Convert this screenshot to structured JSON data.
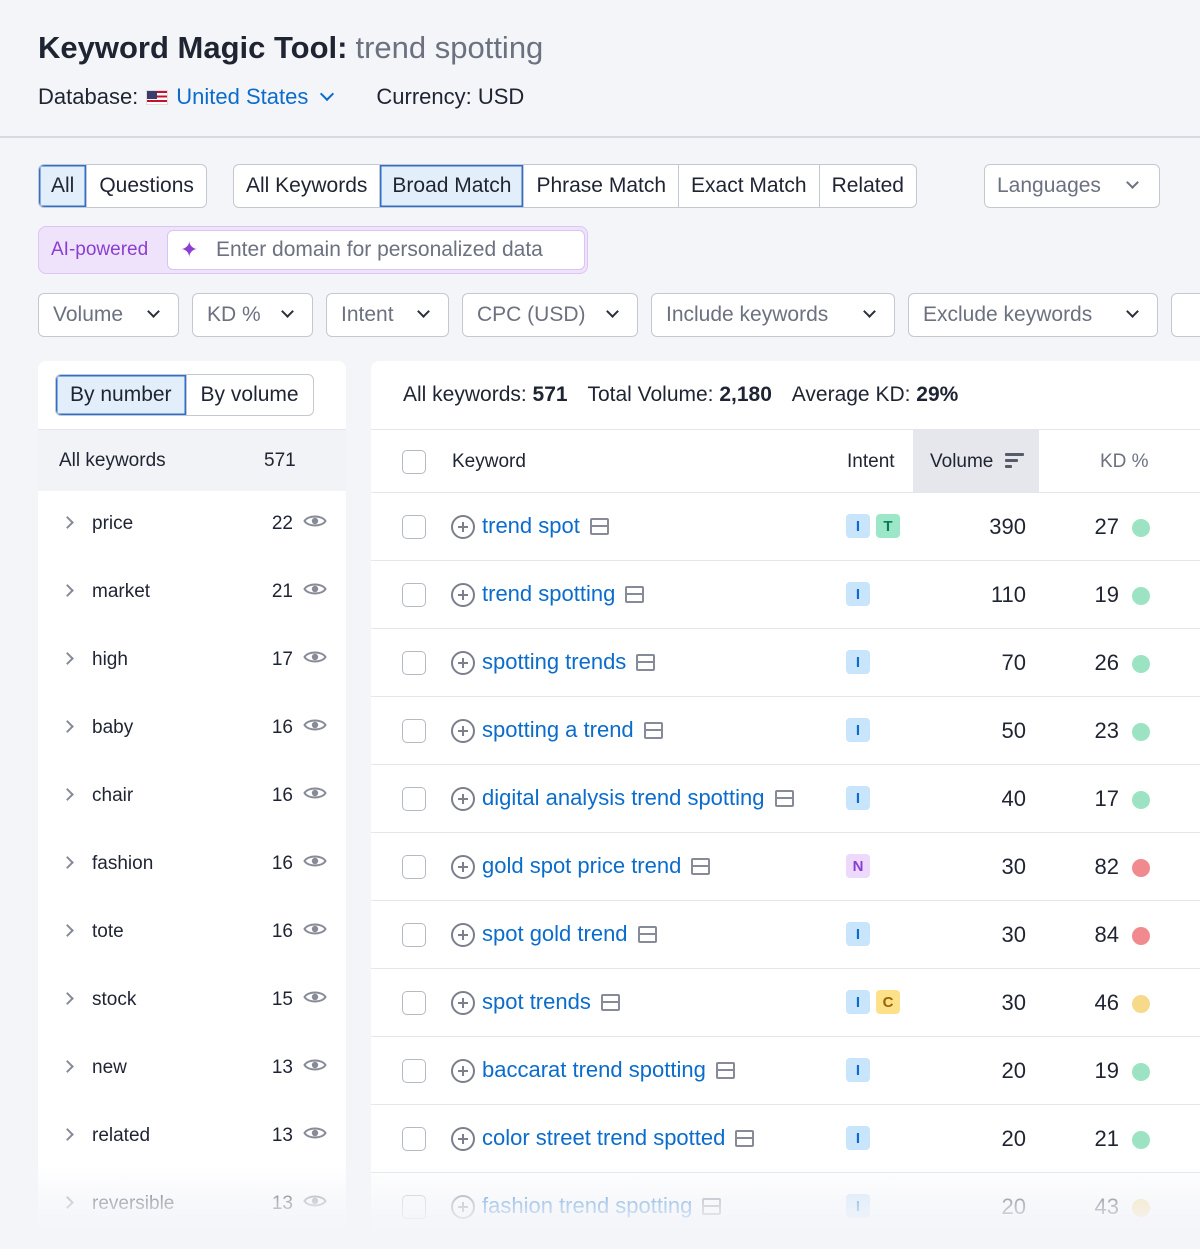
{
  "header": {
    "title": "Keyword Magic Tool:",
    "query": "trend spotting",
    "database_label": "Database:",
    "database_value": "United States",
    "currency": "Currency: USD"
  },
  "tabs_questions": [
    "All",
    "Questions"
  ],
  "tabs_match": [
    "All Keywords",
    "Broad Match",
    "Phrase Match",
    "Exact Match",
    "Related"
  ],
  "languages_label": "Languages",
  "ai": {
    "label": "AI-powered",
    "placeholder": "Enter domain for personalized data"
  },
  "filters": [
    "Volume",
    "KD %",
    "Intent",
    "CPC (USD)",
    "Include keywords",
    "Exclude keywords"
  ],
  "sidebar": {
    "toggle": [
      "By number",
      "By volume"
    ],
    "all_label": "All keywords",
    "all_count": "571",
    "groups": [
      {
        "label": "price",
        "count": "22"
      },
      {
        "label": "market",
        "count": "21"
      },
      {
        "label": "high",
        "count": "17"
      },
      {
        "label": "baby",
        "count": "16"
      },
      {
        "label": "chair",
        "count": "16"
      },
      {
        "label": "fashion",
        "count": "16"
      },
      {
        "label": "tote",
        "count": "16"
      },
      {
        "label": "stock",
        "count": "15"
      },
      {
        "label": "new",
        "count": "13"
      },
      {
        "label": "related",
        "count": "13"
      },
      {
        "label": "reversible",
        "count": "13"
      }
    ]
  },
  "stats": {
    "all_keywords_label": "All keywords:",
    "all_keywords_value": "571",
    "total_volume_label": "Total Volume:",
    "total_volume_value": "2,180",
    "avg_kd_label": "Average KD:",
    "avg_kd_value": "29%"
  },
  "table": {
    "columns": [
      "Keyword",
      "Intent",
      "Volume",
      "KD %"
    ],
    "rows": [
      {
        "keyword": "trend spot",
        "intent": [
          "I",
          "T"
        ],
        "volume": "390",
        "kd": "27",
        "kd_color": "#9be3c3"
      },
      {
        "keyword": "trend spotting",
        "intent": [
          "I"
        ],
        "volume": "110",
        "kd": "19",
        "kd_color": "#9be3c3"
      },
      {
        "keyword": "spotting trends",
        "intent": [
          "I"
        ],
        "volume": "70",
        "kd": "26",
        "kd_color": "#9be3c3"
      },
      {
        "keyword": "spotting a trend",
        "intent": [
          "I"
        ],
        "volume": "50",
        "kd": "23",
        "kd_color": "#9be3c3"
      },
      {
        "keyword": "digital analysis trend spotting",
        "intent": [
          "I"
        ],
        "volume": "40",
        "kd": "17",
        "kd_color": "#9be3c3"
      },
      {
        "keyword": "gold spot price trend",
        "intent": [
          "N"
        ],
        "volume": "30",
        "kd": "82",
        "kd_color": "#f08a8f"
      },
      {
        "keyword": "spot gold trend",
        "intent": [
          "I"
        ],
        "volume": "30",
        "kd": "84",
        "kd_color": "#f08a8f"
      },
      {
        "keyword": "spot trends",
        "intent": [
          "I",
          "C"
        ],
        "volume": "30",
        "kd": "46",
        "kd_color": "#f7d98a"
      },
      {
        "keyword": "baccarat trend spotting",
        "intent": [
          "I"
        ],
        "volume": "20",
        "kd": "19",
        "kd_color": "#9be3c3"
      },
      {
        "keyword": "color street trend spotted",
        "intent": [
          "I"
        ],
        "volume": "20",
        "kd": "21",
        "kd_color": "#9be3c3"
      },
      {
        "keyword": "fashion trend spotting",
        "intent": [
          "I"
        ],
        "volume": "20",
        "kd": "43",
        "kd_color": "#f7d98a"
      }
    ]
  }
}
